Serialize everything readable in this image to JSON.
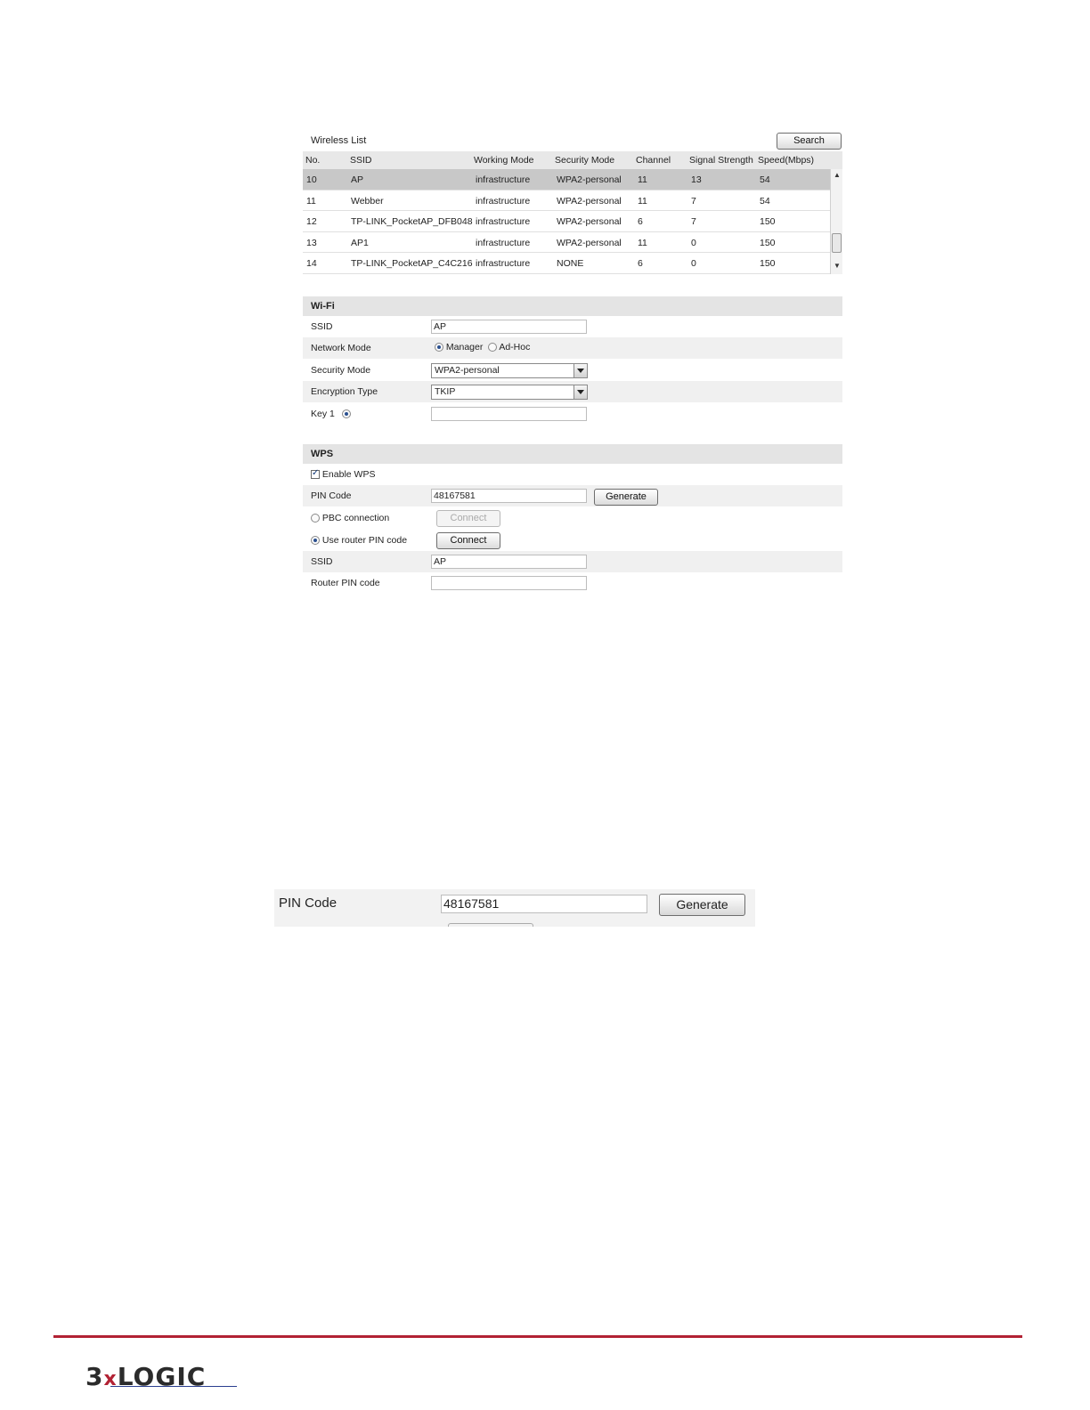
{
  "wireless_list": {
    "title": "Wireless List",
    "search_label": "Search",
    "columns": [
      "No.",
      "SSID",
      "Working Mode",
      "Security Mode",
      "Channel",
      "Signal Strength",
      "Speed(Mbps)"
    ],
    "rows": [
      {
        "no": "10",
        "ssid": "AP",
        "mode": "infrastructure",
        "security": "WPA2-personal",
        "channel": "11",
        "signal": "13",
        "speed": "54"
      },
      {
        "no": "11",
        "ssid": "Webber",
        "mode": "infrastructure",
        "security": "WPA2-personal",
        "channel": "11",
        "signal": "7",
        "speed": "54"
      },
      {
        "no": "12",
        "ssid": "TP-LINK_PocketAP_DFB048",
        "mode": "infrastructure",
        "security": "WPA2-personal",
        "channel": "6",
        "signal": "7",
        "speed": "150"
      },
      {
        "no": "13",
        "ssid": "AP1",
        "mode": "infrastructure",
        "security": "WPA2-personal",
        "channel": "11",
        "signal": "0",
        "speed": "150"
      },
      {
        "no": "14",
        "ssid": "TP-LINK_PocketAP_C4C216",
        "mode": "infrastructure",
        "security": "NONE",
        "channel": "6",
        "signal": "0",
        "speed": "150"
      }
    ],
    "selected_row": "10"
  },
  "wifi": {
    "heading": "Wi-Fi",
    "ssid_label": "SSID",
    "ssid_value": "AP",
    "network_mode_label": "Network Mode",
    "network_mode_options": [
      "Manager",
      "Ad-Hoc"
    ],
    "network_mode_selected": "Manager",
    "security_mode_label": "Security Mode",
    "security_mode_value": "WPA2-personal",
    "encryption_label": "Encryption Type",
    "encryption_value": "TKIP",
    "key1_label": "Key 1",
    "key1_value": ""
  },
  "wps": {
    "heading": "WPS",
    "enable_label": "Enable WPS",
    "enable_checked": true,
    "pin_label": "PIN Code",
    "pin_value": "48167581",
    "generate_label": "Generate",
    "pbc_label": "PBC connection",
    "pbc_connect_label": "Connect",
    "router_pin_option_label": "Use router PIN code",
    "router_connect_label": "Connect",
    "ssid_label": "SSID",
    "ssid_value": "AP",
    "router_pin_label": "Router PIN code",
    "router_pin_value": ""
  },
  "zoom_detail": {
    "pin_label": "PIN Code",
    "pin_value": "48167581",
    "generate_label": "Generate"
  },
  "footer": {
    "logo_text_a": "3",
    "logo_text_x": "x",
    "logo_text_b": "LOGIC",
    "accent_color": "#b22234"
  }
}
